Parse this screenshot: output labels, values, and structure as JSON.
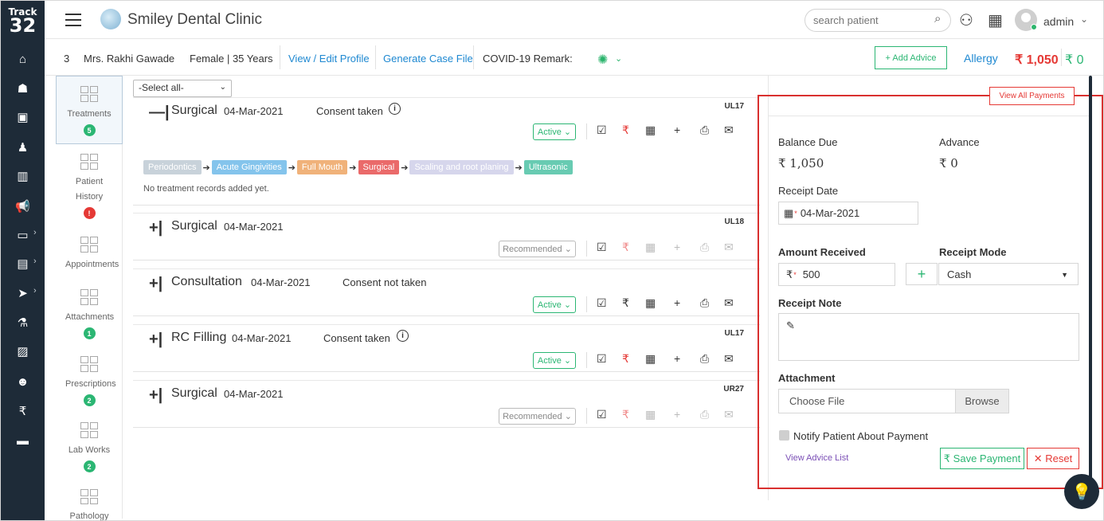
{
  "sidebar": {
    "logo_line1": "Track",
    "logo_line2": "32",
    "icons": [
      "home-icon",
      "dentist-icon",
      "gallery-icon",
      "user-icon",
      "library-icon",
      "megaphone-icon",
      "monitor-icon",
      "document-icon",
      "send-icon",
      "flask-icon",
      "clipboard-icon",
      "group-icon",
      "rupee-icon",
      "book-icon"
    ],
    "glyphs": [
      "⌂",
      "☗",
      "▣",
      "♟",
      "▥",
      "📢",
      "▭",
      "▤",
      "➤",
      "⚗",
      "▨",
      "☻",
      "₹",
      "▬"
    ]
  },
  "header": {
    "clinic_name": "Smiley Dental Clinic",
    "search_placeholder": "search patient",
    "user_name": "admin"
  },
  "patient": {
    "number": "3",
    "name": "Mrs. Rakhi Gawade",
    "gender_age": "Female | 35 Years",
    "view_edit_profile": "View / Edit Profile",
    "generate_case_file": "Generate Case File",
    "covid_remark_label": "COVID-19 Remark:",
    "add_advice_label": "+ Add Advice",
    "allergy_label": "Allergy",
    "amount_red": "₹ 1,050",
    "amount_green": "₹ 0"
  },
  "leftnav": {
    "items": [
      {
        "label": "Treatments",
        "badge": "5",
        "badge_color": "#2bb673"
      },
      {
        "label": "Patient History",
        "badge": "!",
        "badge_color": "#e53935"
      },
      {
        "label": "Appointments",
        "badge": ""
      },
      {
        "label": "Attachments",
        "badge": "1",
        "badge_color": "#2bb673"
      },
      {
        "label": "Prescriptions",
        "badge": "2",
        "badge_color": "#2bb673"
      },
      {
        "label": "Lab Works",
        "badge": "2",
        "badge_color": "#2bb673"
      },
      {
        "label": "Pathology",
        "badge": ""
      }
    ]
  },
  "treatments": {
    "select_all": "-Select all-",
    "cards": [
      {
        "toggle": "—|",
        "title": "Surgical",
        "date": "04-Mar-2021",
        "consent": "Consent taken",
        "has_info": true,
        "tooth": "UL17",
        "status": "Active",
        "chain": [
          "Periodontics",
          "Acute Gingivities",
          "Full Mouth",
          "Surgical",
          "Scaling and root planing",
          "Ultrasonic"
        ],
        "no_records": "No treatment records added yet."
      },
      {
        "toggle": "+|",
        "title": "Surgical",
        "date": "04-Mar-2021",
        "consent": "",
        "has_info": false,
        "tooth": "UL18",
        "status": "Recommended"
      },
      {
        "toggle": "+|",
        "title": "Consultation",
        "date": "04-Mar-2021",
        "consent": "Consent not taken",
        "has_info": false,
        "tooth": "",
        "status": "Active"
      },
      {
        "toggle": "+|",
        "title": "RC Filling",
        "date": "04-Mar-2021",
        "consent": "Consent taken",
        "has_info": true,
        "tooth": "UL17",
        "status": "Active"
      },
      {
        "toggle": "+|",
        "title": "Surgical",
        "date": "04-Mar-2021",
        "consent": "",
        "has_info": false,
        "tooth": "UR27",
        "status": "Recommended"
      }
    ],
    "chain_colors": [
      "#c8d2da",
      "#84c4ec",
      "#f0b27a",
      "#ea6a6a",
      "#d6d6ec",
      "#68cbb2"
    ]
  },
  "payment": {
    "view_all_payments": "View All Payments",
    "balance_due_label": "Balance Due",
    "balance_due_value": "₹ 1,050",
    "advance_label": "Advance",
    "advance_value": "₹ 0",
    "receipt_date_label": "Receipt Date",
    "receipt_date_value": "04-Mar-2021",
    "amount_received_label": "Amount Received",
    "amount_received_value": "500",
    "receipt_mode_label": "Receipt Mode",
    "receipt_mode_value": "Cash",
    "receipt_note_label": "Receipt Note",
    "attachment_label": "Attachment",
    "choose_file": "Choose File",
    "browse": "Browse",
    "notify_label": "Notify Patient About Payment",
    "view_advice_list": "View Advice List",
    "save_payment": "₹ Save Payment",
    "reset": "✕ Reset"
  }
}
